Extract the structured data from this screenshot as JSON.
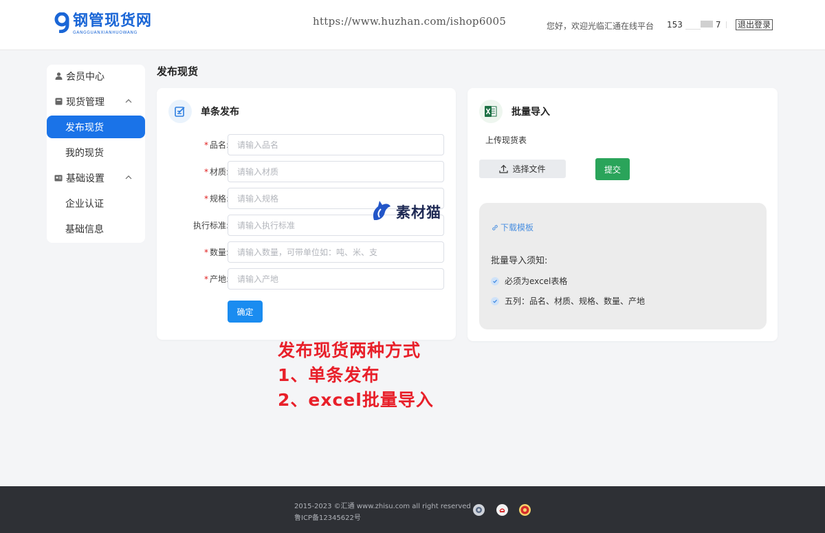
{
  "header": {
    "logo_title": "钢管现货网",
    "logo_sub": "GANGGUANXIANHUOWANG",
    "watermark_url": "https://www.huzhan.com/ishop6005",
    "welcome": "您好，欢迎光临汇通在线平台",
    "phone_prefix": "153",
    "phone_suffix": "7",
    "logout": "退出登录"
  },
  "sidebar": {
    "member_center": "会员中心",
    "stock_mgmt": "现货管理",
    "publish_stock": "发布现货",
    "my_stock": "我的现货",
    "basic_settings": "基础设置",
    "company_cert": "企业认证",
    "basic_info": "基础信息"
  },
  "page": {
    "title": "发布现货"
  },
  "single": {
    "title": "单条发布",
    "fields": [
      {
        "label": "品名:",
        "required": true,
        "placeholder": "请输入品名"
      },
      {
        "label": "材质:",
        "required": true,
        "placeholder": "请输入材质"
      },
      {
        "label": "规格:",
        "required": true,
        "placeholder": "请输入规格"
      },
      {
        "label": "执行标准:",
        "required": false,
        "placeholder": "请输入执行标准"
      },
      {
        "label": "数量:",
        "required": true,
        "placeholder": "请输入数量，可带单位如：吨、米、支"
      },
      {
        "label": "产地:",
        "required": true,
        "placeholder": "请输入产地"
      }
    ],
    "required_mark": "*",
    "confirm": "确定"
  },
  "batch": {
    "title": "批量导入",
    "upload_label": "上传现货表",
    "choose_file": "选择文件",
    "submit": "提交",
    "download_template": "下载模板",
    "notice_title": "批量导入须知:",
    "notice_items": [
      "必须为excel表格",
      "五列：品名、材质、规格、数量、产地"
    ]
  },
  "watermark_logo": "素材猫",
  "annotation": [
    "发布现货两种方式",
    "1、单条发布",
    "2、excel批量导入"
  ],
  "footer": {
    "copyright": "2015-2023 ©汇通 www.zhisu.com all right reserved",
    "icp": "鲁ICP备12345622号"
  },
  "colors": {
    "primary": "#1a73e8",
    "brand_blue": "#1a66d6",
    "submit_green": "#2aa45a",
    "annotation_red": "#e8202a",
    "footer_bg": "#2e3035"
  },
  "icons": {
    "user": "user-icon",
    "stock": "stock-icon",
    "settings": "id-card-icon",
    "edit": "edit-icon",
    "excel": "excel-icon",
    "upload": "upload-icon",
    "link": "link-icon",
    "check": "check-icon"
  }
}
